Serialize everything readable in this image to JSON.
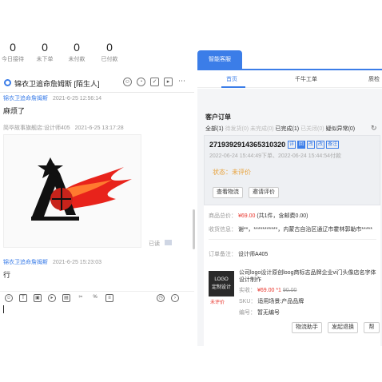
{
  "stats": [
    {
      "value": "0",
      "label": "今日接待"
    },
    {
      "value": "0",
      "label": "未下单"
    },
    {
      "value": "0",
      "label": "未付款"
    },
    {
      "value": "0",
      "label": "已付款"
    }
  ],
  "chat": {
    "title": "锦衣卫追命詹姆斯 [陌生人]",
    "messages": [
      {
        "sender": "锦衣卫追命詹姆斯",
        "time": "2021-6-25 12:56:14",
        "text": "麻烦了"
      },
      {
        "sender": "简毕故事旗舰店:设计师405",
        "time": "2021-6-25 13:17:28"
      },
      {
        "sender": "锦衣卫追命詹姆斯",
        "time": "2021-6-25 15:23:03",
        "text": "行"
      }
    ],
    "read_label": "已读",
    "toolbar_icons": [
      "emoji-icon",
      "text-icon",
      "image-icon",
      "video-icon",
      "file-icon",
      "cut-icon",
      "percent-icon",
      "doc-icon",
      "history-icon",
      "arrow-icon"
    ]
  },
  "right": {
    "tab_label": "智能客服",
    "subtabs": [
      "首页",
      "千牛工单",
      "质检"
    ],
    "section_title": "客户订单",
    "filters": {
      "all": "全部(1)",
      "pending_pay": "待发货(0)",
      "unfinished": "未完成(0)",
      "completed": "已完成(1)",
      "closed": "已关闭(0)",
      "suspect": "疑似异常(0)"
    },
    "order": {
      "id": "2719392914365310320",
      "badges": [
        "详",
        "回",
        "改",
        "改"
      ],
      "note_badge": "备注",
      "time": "2022-06-24 15:44:49下单、2022-06-24 15:44:54付款",
      "status_key": "状态：",
      "status_value": "未评价",
      "buttons": [
        "查看物流",
        "邀请评价"
      ]
    },
    "info": {
      "total_key": "商品总价：",
      "total_price": "¥69.00",
      "total_extra": "(共1件，含邮费0.00)",
      "address_key": "收货信息：",
      "address_value": "谢**，***********，内蒙古自治区通辽市霍林郭勒市*****",
      "note_key": "订单备注：",
      "note_value": "设计师A405",
      "product_name": "公司logo设计原创loog商标志品牌企业vi门头像店名字体设计制作",
      "paid_key": "实收：",
      "paid_price": "¥69.00",
      "qty": "*1",
      "orig_price": "90.00",
      "sku_key": "SKU：",
      "sku_value": "适用场景:产品品牌",
      "code_key": "编号：",
      "code_value": "暂无编号",
      "thumb_text": "LOGO",
      "thumb_sub": "定制设计",
      "tag": "未评价",
      "buttons": [
        "物流助手",
        "发起退换",
        "帮"
      ]
    }
  },
  "colors": {
    "accent": "#3b7de8",
    "price": "#e8342b",
    "status": "#e8a23b"
  }
}
